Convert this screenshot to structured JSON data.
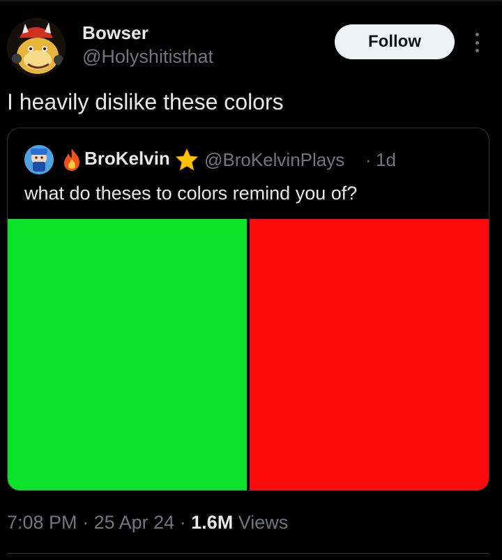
{
  "tweet": {
    "author_name": "Bowser",
    "author_handle": "@Holyshitisthat",
    "follow_label": "Follow",
    "text": "I heavily dislike these colors",
    "time": "7:08 PM",
    "sep1": " · ",
    "date": "25 Apr 24",
    "sep2": " · ",
    "views_count": "1.6M",
    "views_label": " Views"
  },
  "quote": {
    "author_name": "BroKelvin",
    "author_handle": "@BroKelvinPlays",
    "separator": "·",
    "time": "1d",
    "text": "what do theses to colors remind you of?",
    "image": {
      "left_color": "#0BE22A",
      "right_color": "#FD0B0B"
    }
  },
  "icons": {
    "fire": "fire-icon",
    "star": "star-icon",
    "more": "more-options-icon"
  }
}
